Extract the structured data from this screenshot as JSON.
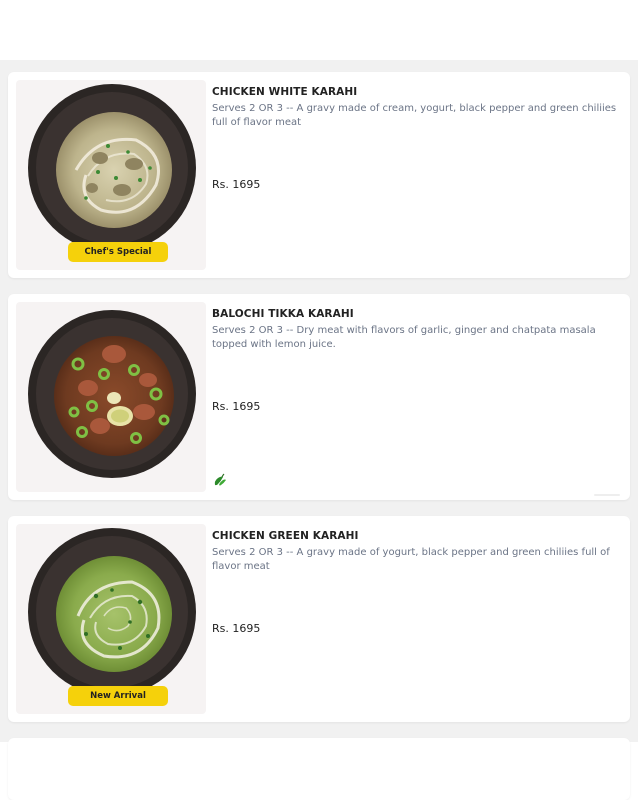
{
  "menu": {
    "items": [
      {
        "name": "CHICKEN WHITE KARAHI",
        "description": "Serves 2 OR 3 -- A gravy made of cream, yogurt, black pepper and green chiliies full of flavor meat",
        "price": "Rs. 1695",
        "badge": "Chef's Special",
        "image_icon": "white-karahi-icon"
      },
      {
        "name": "BALOCHI TIKKA KARAHI",
        "description": "Serves 2 OR 3 -- Dry meat with flavors of garlic, ginger and chatpata masala topped with lemon juice.",
        "price": "Rs. 1695",
        "spicy_icon": "chili-icon",
        "image_icon": "balochi-karahi-icon"
      },
      {
        "name": "CHICKEN GREEN KARAHI",
        "description": "Serves 2 OR 3 -- A gravy made of yogurt, black pepper and green chiliies full of flavor meat",
        "price": "Rs. 1695",
        "badge": "New Arrival",
        "image_icon": "green-karahi-icon"
      }
    ]
  },
  "colors": {
    "badge_bg": "#f5d10b",
    "desc_text": "#6b7486",
    "title_text": "#222222",
    "list_bg": "#f1f1f1"
  }
}
